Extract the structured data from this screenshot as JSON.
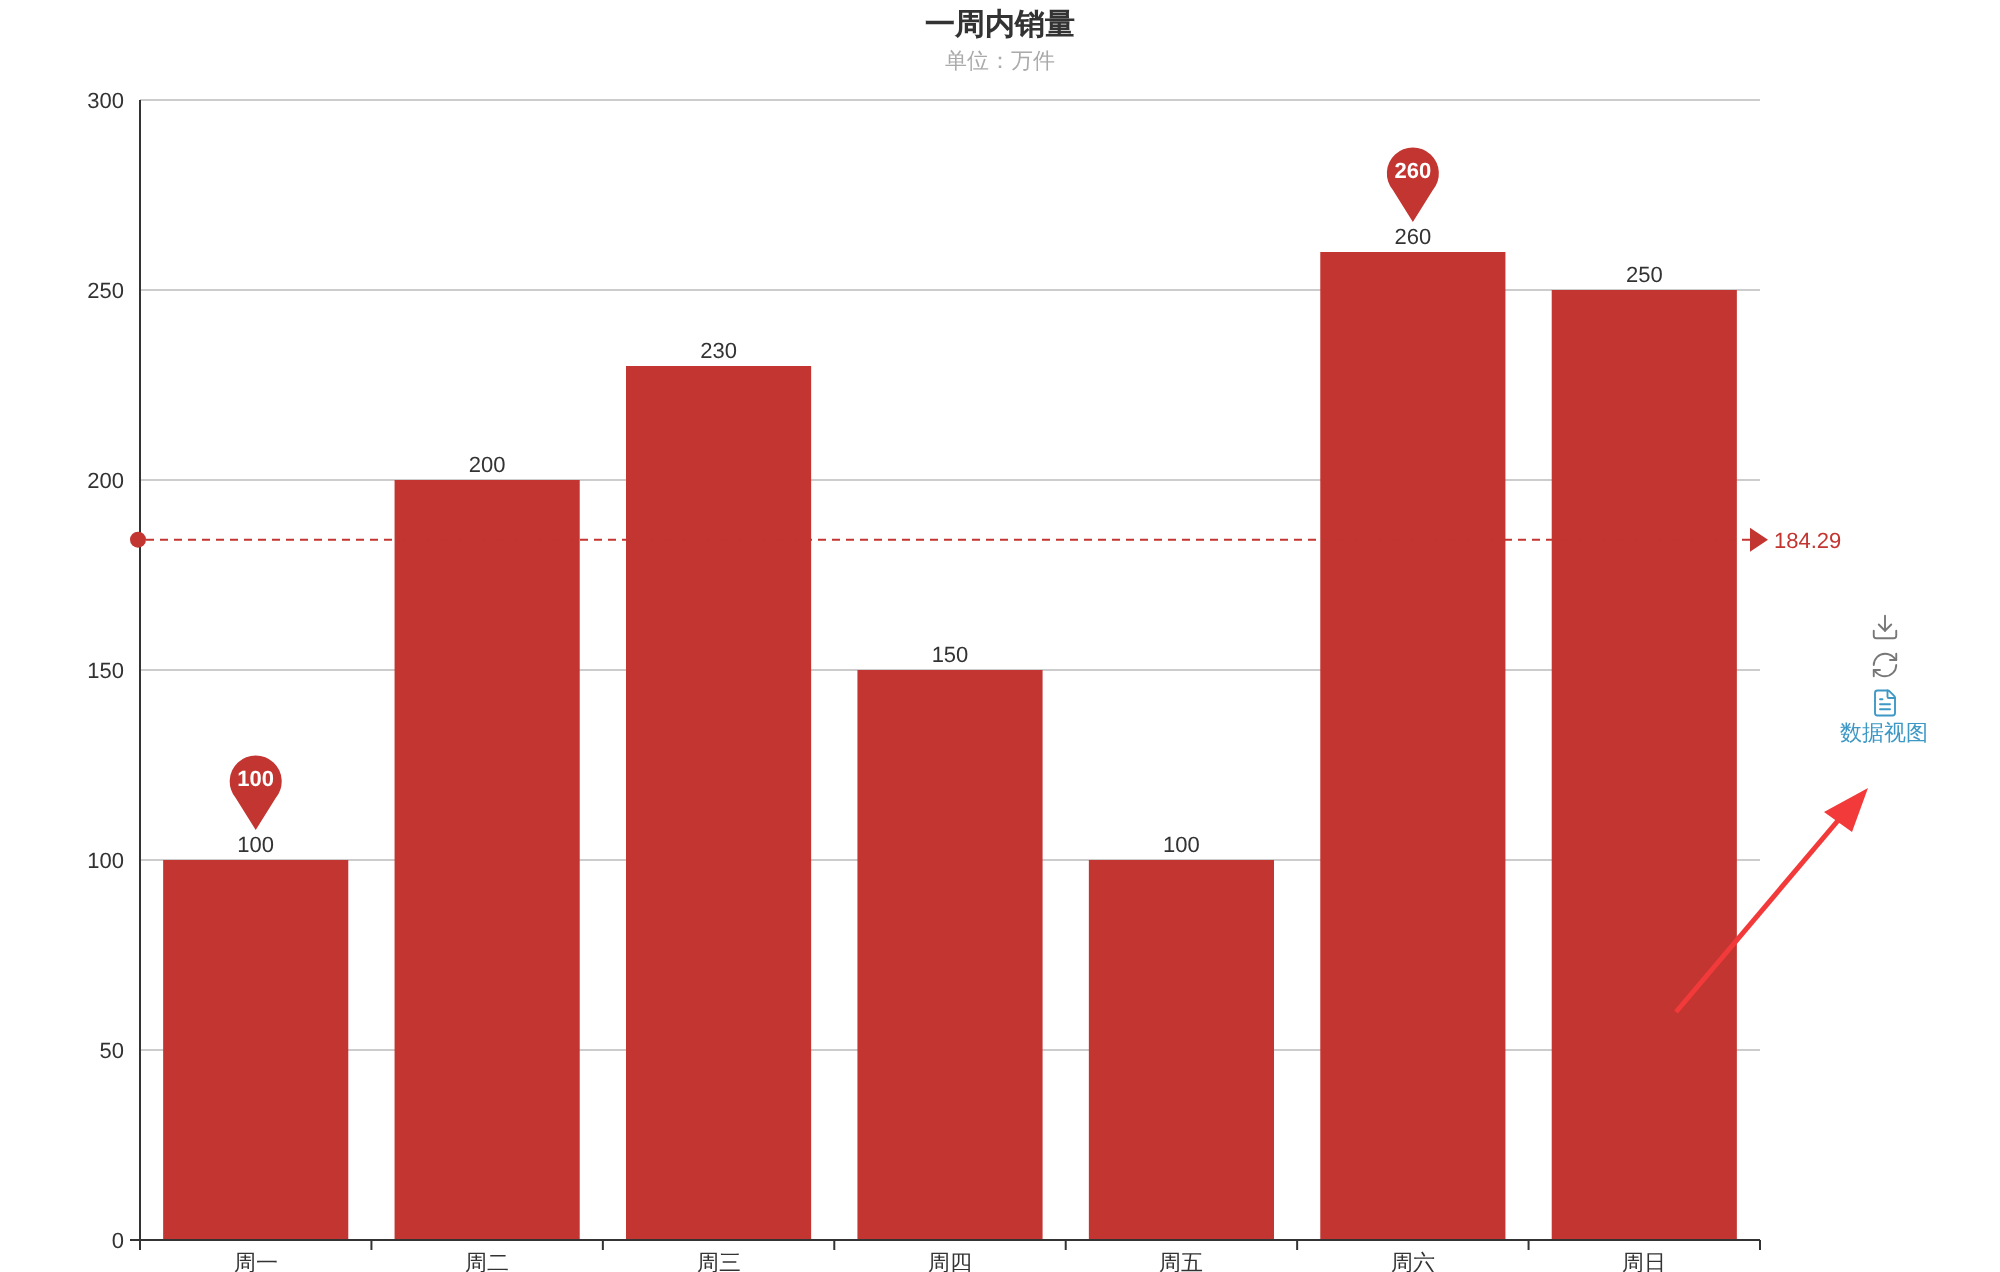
{
  "chart": {
    "subtitle": "单位：万件",
    "chart_data": {
      "type": "bar",
      "title": "一周内销量",
      "categories": [
        "周一",
        "周二",
        "周三",
        "周四",
        "周五",
        "周六",
        "周日"
      ],
      "series": [
        {
          "color": "#c23531",
          "values": [
            100,
            200,
            230,
            150,
            100,
            260,
            250
          ]
        }
      ],
      "ylim": [
        0,
        300
      ],
      "yticks": [
        0,
        50,
        100,
        150,
        200,
        250,
        300
      ],
      "data_labels": true,
      "grid": true,
      "annotations": [
        "100",
        "260"
      ],
      "ref_lines": [
        {
          "axis": "y",
          "value": 184.29,
          "label": "184.29",
          "color": "#c23531"
        }
      ]
    }
  },
  "toolbox": {
    "items": [
      {
        "kind": "save"
      },
      {
        "kind": "restore"
      },
      {
        "kind": "dataview",
        "label": "数据视图"
      }
    ]
  }
}
